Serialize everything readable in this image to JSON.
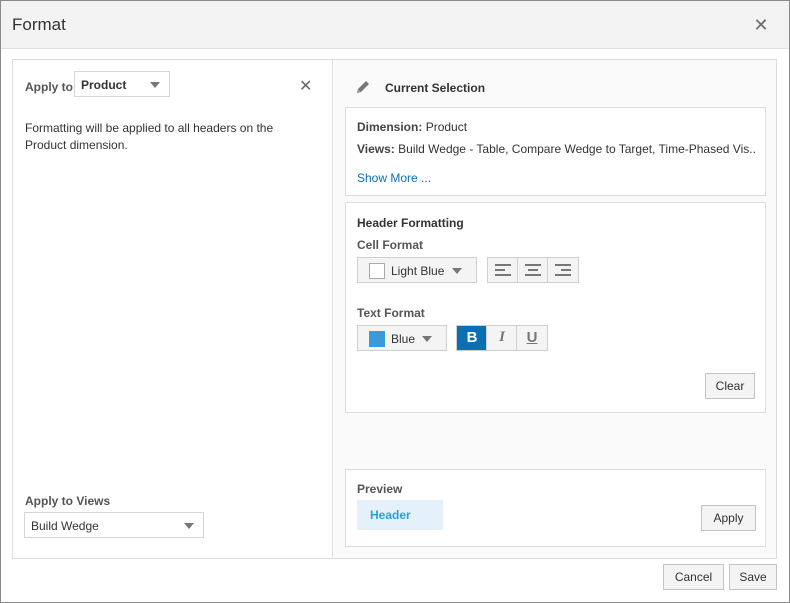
{
  "window": {
    "title": "Format",
    "close_icon": "close-icon"
  },
  "left": {
    "apply_to_label": "Apply to",
    "apply_to_value": "Product",
    "description": "Formatting will be applied to all headers on the Product dimension.",
    "apply_to_views_label": "Apply to Views",
    "apply_to_views_value": "Build Wedge"
  },
  "right": {
    "current_selection_label": "Current Selection",
    "dimension_label": "Dimension:",
    "dimension_value": "Product",
    "views_label": "Views:",
    "views_value": "Build Wedge - Table, Compare Wedge to Target, Time-Phased Vis...",
    "show_more": "Show More ...",
    "header_formatting": {
      "title": "Header Formatting",
      "cell_format_label": "Cell Format",
      "cell_color_name": "Light Blue",
      "cell_color_hex": "#ffffff",
      "text_format_label": "Text Format",
      "text_color_name": "Blue",
      "text_color_hex": "#3b9ad9",
      "bold": "B",
      "italic": "I",
      "underline": "U",
      "clear": "Clear"
    },
    "preview": {
      "title": "Preview",
      "sample": "Header",
      "apply": "Apply"
    }
  },
  "footer": {
    "cancel": "Cancel",
    "save": "Save"
  },
  "colors": {
    "accent": "#0b6fb4",
    "preview_bg": "#e4f1fb",
    "preview_text": "#2d9fd8"
  }
}
